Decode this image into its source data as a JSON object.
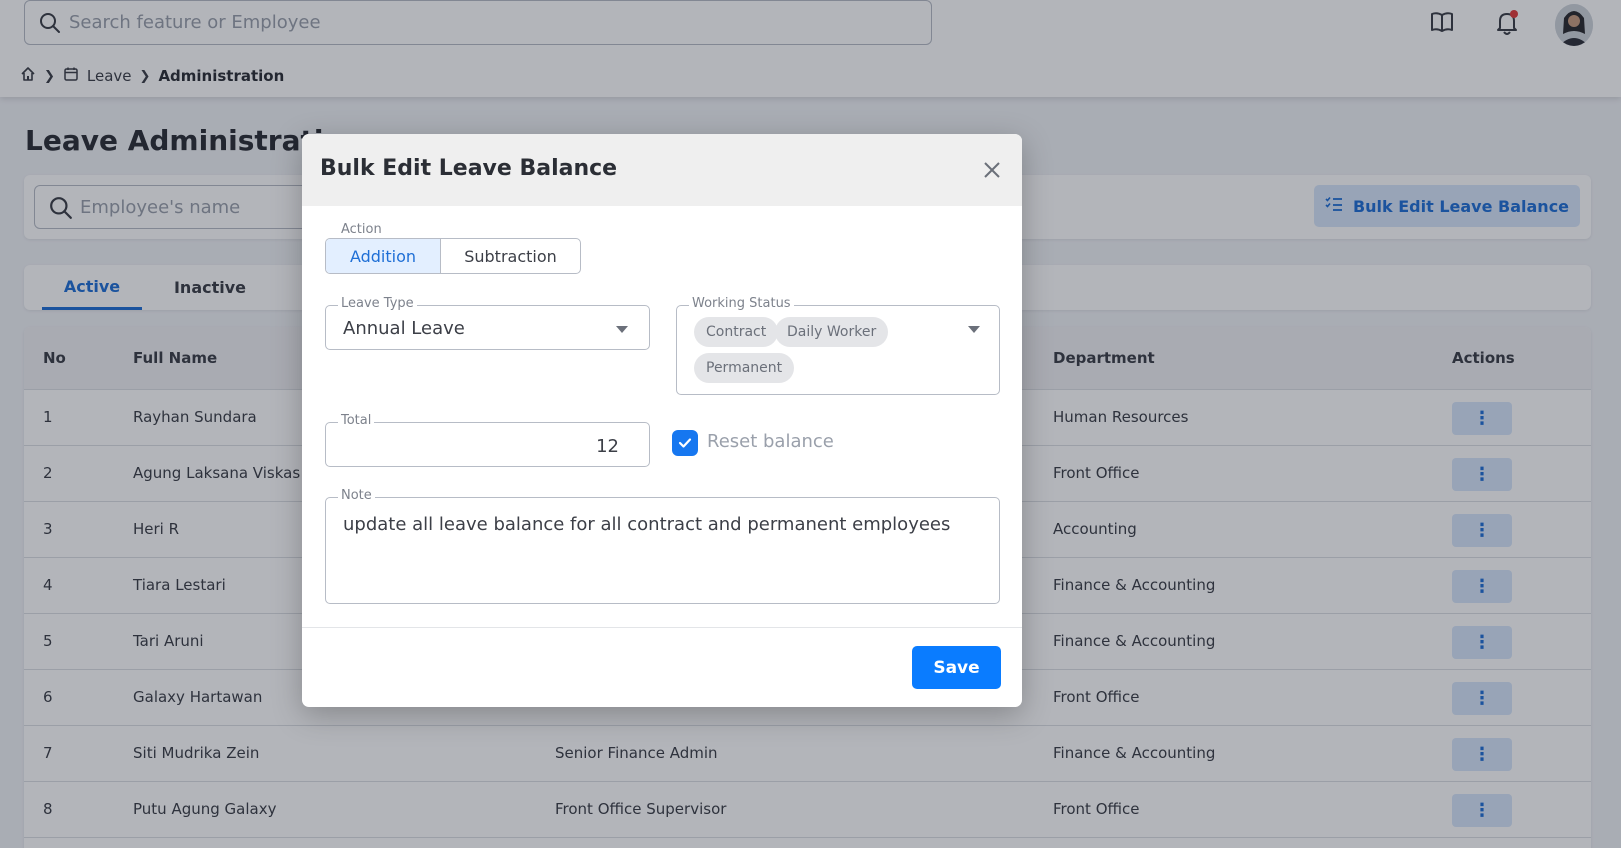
{
  "header": {
    "search_placeholder": "Search feature or Employee",
    "icons": [
      "book-icon",
      "bell-icon",
      "avatar"
    ],
    "notification_dot_color": "#e23b3b"
  },
  "breadcrumb": {
    "items": [
      "Leave",
      "Administration"
    ]
  },
  "page": {
    "title": "Leave Administration",
    "employee_search_placeholder": "Employee's name",
    "bulk_edit_button": "Bulk Edit Leave Balance"
  },
  "tabs": [
    {
      "label": "Active",
      "active": true
    },
    {
      "label": "Inactive",
      "active": false
    }
  ],
  "table": {
    "headers": {
      "no": "No",
      "full_name": "Full Name",
      "department": "Department",
      "actions": "Actions"
    },
    "rows": [
      {
        "no": "1",
        "name": "Rayhan Sundara",
        "position": "",
        "department": "Human Resources"
      },
      {
        "no": "2",
        "name": "Agung Laksana Viskas",
        "position": "",
        "department": "Front Office"
      },
      {
        "no": "3",
        "name": "Heri R",
        "position": "",
        "department": "Accounting"
      },
      {
        "no": "4",
        "name": "Tiara Lestari",
        "position": "",
        "department": "Finance & Accounting"
      },
      {
        "no": "5",
        "name": "Tari Aruni",
        "position": "",
        "department": "Finance & Accounting"
      },
      {
        "no": "6",
        "name": "Galaxy Hartawan",
        "position": "",
        "department": "Front Office"
      },
      {
        "no": "7",
        "name": "Siti Mudrika Zein",
        "position": "Senior Finance Admin",
        "department": "Finance & Accounting"
      },
      {
        "no": "8",
        "name": "Putu Agung Galaxy",
        "position": "Front Office Supervisor",
        "department": "Front Office"
      }
    ],
    "row_action_label": "⋮"
  },
  "modal": {
    "title": "Bulk Edit Leave Balance",
    "action_label": "Action",
    "action_options": [
      "Addition",
      "Subtraction"
    ],
    "action_selected": "Addition",
    "leave_type_label": "Leave Type",
    "leave_type_value": "Annual Leave",
    "working_status_label": "Working Status",
    "working_status_chips": [
      "Contract",
      "Daily Worker",
      "Permanent"
    ],
    "total_label": "Total",
    "total_value": "12",
    "reset_balance_label": "Reset balance",
    "reset_balance_checked": true,
    "note_label": "Note",
    "note_value": "update all leave balance for all contract and  permanent employees",
    "save_label": "Save"
  },
  "colors": {
    "primary": "#0a7cff",
    "accent_light": "#d7e6fb",
    "overlay": "rgba(20,24,40,0.32)"
  }
}
